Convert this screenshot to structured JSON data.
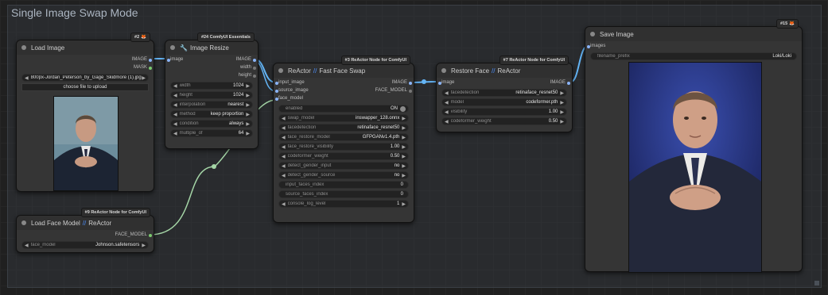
{
  "group": {
    "title": "Single Image Swap Mode"
  },
  "load_image": {
    "title": "Load Image",
    "badge": "#2",
    "outputs": [
      "IMAGE",
      "MASK"
    ],
    "image_widget_value": "800px-Jordan_Peterson_by_Gage_Skidmore (1).jpg",
    "upload_label": "choose file to upload"
  },
  "image_resize": {
    "title": "Image Resize",
    "badge": "#24 ComfyUI Essentials",
    "input": "image",
    "outputs": [
      "IMAGE",
      "width",
      "height"
    ],
    "widgets": [
      {
        "name": "width",
        "value": "1024"
      },
      {
        "name": "height",
        "value": "1024"
      },
      {
        "name": "interpolation",
        "value": "nearest"
      },
      {
        "name": "method",
        "value": "keep proportion"
      },
      {
        "name": "condition",
        "value": "always"
      },
      {
        "name": "multiple_of",
        "value": "64"
      }
    ]
  },
  "reactor": {
    "title": "ReActor",
    "subtitle": "Fast Face Swap",
    "badge": "#3 ReActor Node for ComfyUI",
    "inputs": [
      "input_image",
      "source_image",
      "face_model"
    ],
    "outputs": [
      "IMAGE",
      "FACE_MODEL"
    ],
    "enabled_label": "enabled",
    "enabled_value": "ON",
    "widgets": [
      {
        "name": "swap_model",
        "value": "inswapper_128.onnx"
      },
      {
        "name": "facedetection",
        "value": "retinaface_resnet50"
      },
      {
        "name": "face_restore_model",
        "value": "GFPGANv1.4.pth"
      },
      {
        "name": "face_restore_visibility",
        "value": "1.00"
      },
      {
        "name": "codeformer_weight",
        "value": "0.50"
      },
      {
        "name": "detect_gender_input",
        "value": "no"
      },
      {
        "name": "detect_gender_source",
        "value": "no"
      }
    ],
    "text_widgets": [
      {
        "name": "input_faces_index",
        "value": "0"
      },
      {
        "name": "source_faces_index",
        "value": "0"
      }
    ],
    "log_widget": {
      "name": "console_log_level",
      "value": "1"
    }
  },
  "restore_face": {
    "title": "Restore Face",
    "subtitle": "ReActor",
    "badge": "#7 ReActor Node for ComfyUI",
    "input": "image",
    "output": "IMAGE",
    "widgets": [
      {
        "name": "facedetection",
        "value": "retinaface_resnet50"
      },
      {
        "name": "model",
        "value": "codeformer.pth"
      },
      {
        "name": "visibility",
        "value": "1.00"
      },
      {
        "name": "codeformer_weight",
        "value": "0.50"
      }
    ]
  },
  "load_face_model": {
    "title": "Load Face Model",
    "subtitle": "ReActor",
    "badge": "#9 ReActor Node for ComfyUI",
    "output": "FACE_MODEL",
    "widget": {
      "name": "face_model",
      "value": "Johnson.safetensors"
    }
  },
  "save_image": {
    "title": "Save Image",
    "badge": "#15",
    "input": "images",
    "widget": {
      "name": "filename_prefix",
      "value": "Loki/Loki"
    }
  },
  "colors": {
    "image_wire": "#64b5f6",
    "face_model_wire": "#a5d6a7",
    "canvas": "#202020",
    "node": "#353535"
  }
}
